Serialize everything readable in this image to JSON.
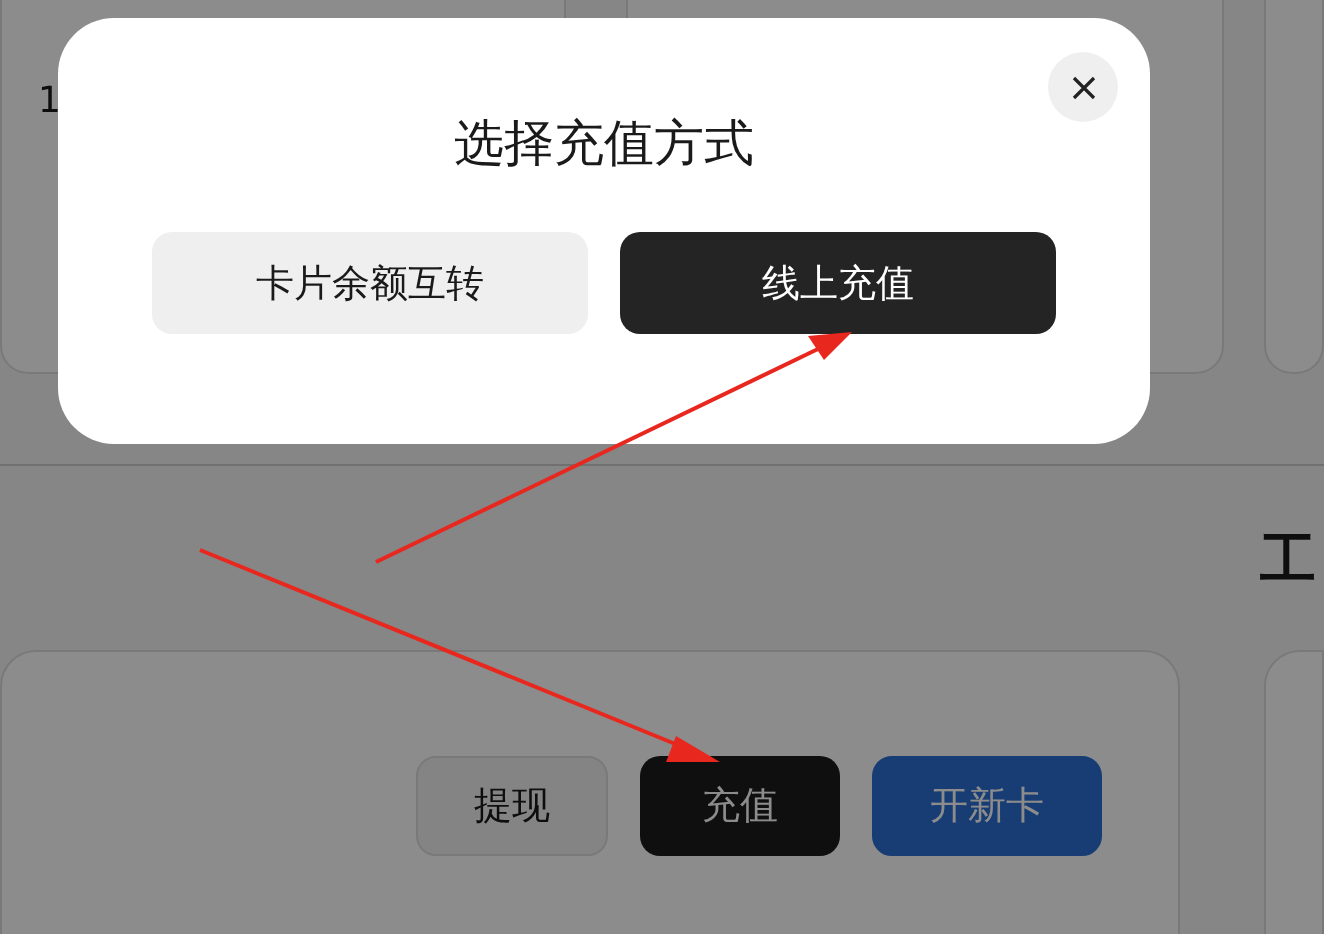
{
  "background": {
    "cards": [
      {
        "value": "1"
      }
    ],
    "section_heading": "工",
    "actions": [
      {
        "label": "提现",
        "kind": "secondary"
      },
      {
        "label": "充值",
        "kind": "dark"
      },
      {
        "label": "开新卡",
        "kind": "primary"
      }
    ]
  },
  "dialog": {
    "title": "选择充值方式",
    "options": [
      {
        "label": "卡片余额互转",
        "kind": "light"
      },
      {
        "label": "线上充值",
        "kind": "dark"
      }
    ]
  }
}
